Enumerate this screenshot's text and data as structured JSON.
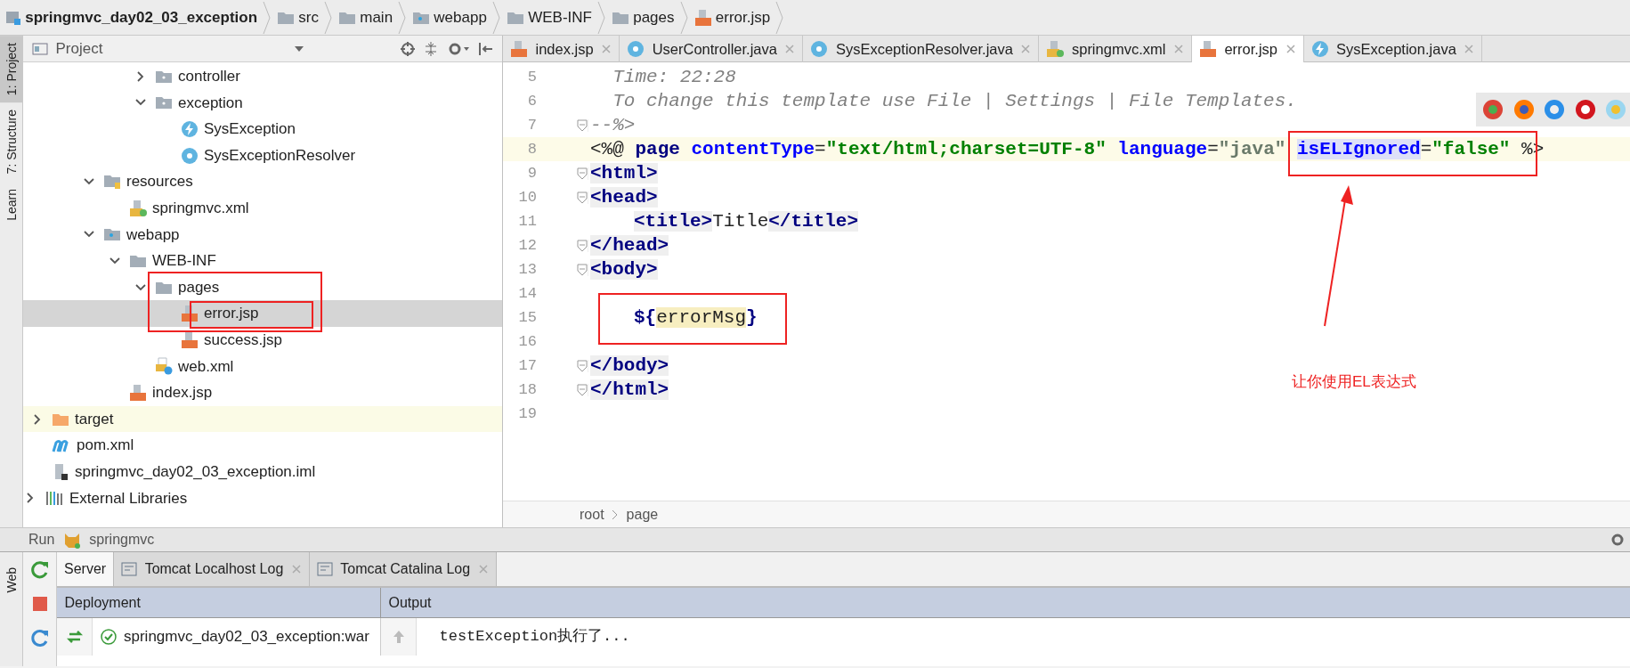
{
  "breadcrumbs": [
    {
      "label": "springmvc_day02_03_exception",
      "kind": "module"
    },
    {
      "label": "src",
      "kind": "folder"
    },
    {
      "label": "main",
      "kind": "folder"
    },
    {
      "label": "webapp",
      "kind": "web-folder"
    },
    {
      "label": "WEB-INF",
      "kind": "folder"
    },
    {
      "label": "pages",
      "kind": "folder"
    },
    {
      "label": "error.jsp",
      "kind": "jsp"
    }
  ],
  "tool_strip": {
    "tabs": [
      {
        "label": "1: Project",
        "selected": true
      },
      {
        "label": "7: Structure",
        "selected": false
      },
      {
        "label": "Learn",
        "selected": false
      }
    ],
    "bottom_tabs": [
      {
        "label": "Web",
        "selected": false
      }
    ]
  },
  "project_panel": {
    "title": "Project",
    "tree": [
      {
        "children": [
          {
            "children": [
              {
                "children": [
                  {
                    "children": [
                      {
                        "children": [
                          {
                            "label": "controller",
                            "kind": "package",
                            "expanded": false,
                            "selected": false
                          },
                          {
                            "label": "exception",
                            "kind": "package",
                            "expanded": true,
                            "selected": false,
                            "children": [
                              {
                                "label": "SysException",
                                "kind": "exception",
                                "selected": false
                              },
                              {
                                "label": "SysExceptionResolver",
                                "kind": "class",
                                "selected": false
                              }
                            ]
                          }
                        ]
                      }
                    ]
                  },
                  {
                    "label": "resources",
                    "kind": "resources",
                    "expanded": true,
                    "selected": false,
                    "children": [
                      {
                        "label": "springmvc.xml",
                        "kind": "xml",
                        "selected": false
                      }
                    ]
                  },
                  {
                    "label": "webapp",
                    "kind": "web-folder",
                    "expanded": true,
                    "selected": false,
                    "children": [
                      {
                        "label": "WEB-INF",
                        "kind": "folder",
                        "expanded": true,
                        "selected": false,
                        "children": [
                          {
                            "label": "pages",
                            "kind": "folder",
                            "expanded": true,
                            "selected": false,
                            "children": [
                              {
                                "label": "error.jsp",
                                "kind": "jsp",
                                "selected": true
                              },
                              {
                                "label": "success.jsp",
                                "kind": "jsp",
                                "selected": false
                              }
                            ]
                          },
                          {
                            "label": "web.xml",
                            "kind": "webxml",
                            "selected": false
                          }
                        ]
                      },
                      {
                        "label": "index.jsp",
                        "kind": "jsp",
                        "selected": false
                      }
                    ]
                  }
                ]
              }
            ]
          },
          {
            "label": "target",
            "kind": "excluded",
            "expanded": false,
            "selected": false
          },
          {
            "label": "pom.xml",
            "kind": "maven",
            "selected": false
          },
          {
            "label": "springmvc_day02_03_exception.iml",
            "kind": "iml",
            "selected": false
          }
        ]
      },
      {
        "label": "External Libraries",
        "kind": "library",
        "expanded": false,
        "selected": false
      }
    ]
  },
  "editor": {
    "tabs": [
      {
        "label": "index.jsp",
        "kind": "jsp",
        "selected": false
      },
      {
        "label": "UserController.java",
        "kind": "class",
        "selected": false
      },
      {
        "label": "SysExceptionResolver.java",
        "kind": "class",
        "selected": false
      },
      {
        "label": "springmvc.xml",
        "kind": "xml",
        "selected": false
      },
      {
        "label": "error.jsp",
        "kind": "jsp",
        "selected": true
      },
      {
        "label": "SysException.java",
        "kind": "exception",
        "selected": false
      }
    ],
    "lines": [
      {
        "number": "5",
        "fold": false,
        "current": false,
        "segments": [
          {
            "text": "  Time: 22:28",
            "kind": "comment"
          }
        ]
      },
      {
        "number": "6",
        "fold": false,
        "current": false,
        "segments": [
          {
            "text": "  To change this template use File | Settings | File Templates.",
            "kind": "comment"
          }
        ]
      },
      {
        "number": "7",
        "fold": true,
        "current": false,
        "segments": [
          {
            "text": "--%>",
            "kind": "comment"
          }
        ]
      },
      {
        "number": "8",
        "fold": false,
        "current": true,
        "segments": [
          {
            "text": "<%@ ",
            "kind": "plain"
          },
          {
            "text": "page",
            "kind": "directive"
          },
          {
            "text": " contentType",
            "kind": "attr"
          },
          {
            "text": "=",
            "kind": "plain"
          },
          {
            "text": "\"text/html;charset=UTF-8\"",
            "kind": "string"
          },
          {
            "text": " language",
            "kind": "attr"
          },
          {
            "text": "=",
            "kind": "plain"
          },
          {
            "text": "\"java\" ",
            "kind": "string-dim"
          },
          {
            "text": "isELIgnored",
            "kind": "attr-hl"
          },
          {
            "text": "=",
            "kind": "plain"
          },
          {
            "text": "\"false\"",
            "kind": "string"
          },
          {
            "text": " %>",
            "kind": "plain"
          }
        ]
      },
      {
        "number": "9",
        "fold": true,
        "current": false,
        "segments": [
          {
            "text": "<html>",
            "kind": "tag"
          }
        ]
      },
      {
        "number": "10",
        "fold": true,
        "current": false,
        "segments": [
          {
            "text": "<head>",
            "kind": "tag"
          }
        ]
      },
      {
        "number": "11",
        "fold": false,
        "current": false,
        "indented": true,
        "segments": [
          {
            "text": "<title>",
            "kind": "tag"
          },
          {
            "text": "Title",
            "kind": "plain"
          },
          {
            "text": "</title>",
            "kind": "tag"
          }
        ]
      },
      {
        "number": "12",
        "fold": true,
        "current": false,
        "segments": [
          {
            "text": "</head>",
            "kind": "tag"
          }
        ]
      },
      {
        "number": "13",
        "fold": true,
        "current": false,
        "segments": [
          {
            "text": "<body>",
            "kind": "tag"
          }
        ]
      },
      {
        "number": "14",
        "fold": false,
        "current": false
      },
      {
        "number": "15",
        "fold": false,
        "current": false,
        "indented": true,
        "segments": [
          {
            "text": "${",
            "kind": "el"
          },
          {
            "text": "errorMsg",
            "kind": "el-var"
          },
          {
            "text": "}",
            "kind": "el"
          }
        ]
      },
      {
        "number": "16",
        "fold": false,
        "current": false
      },
      {
        "number": "17",
        "fold": true,
        "current": false,
        "segments": [
          {
            "text": "</body>",
            "kind": "tag"
          }
        ]
      },
      {
        "number": "18",
        "fold": true,
        "current": false,
        "segments": [
          {
            "text": "</html>",
            "kind": "tag"
          }
        ]
      },
      {
        "number": "19",
        "fold": false,
        "current": false
      }
    ],
    "breadcrumb": [
      "root",
      "page"
    ],
    "note": "让你使用EL表达式"
  },
  "run_panel": {
    "title": "Run",
    "config": "springmvc",
    "tabs": [
      {
        "label": "Server",
        "selected": true,
        "closable": false
      },
      {
        "label": "Tomcat Localhost Log",
        "selected": false,
        "closable": true
      },
      {
        "label": "Tomcat Catalina Log",
        "selected": false,
        "closable": true
      }
    ],
    "columns": [
      "Deployment",
      "Output"
    ],
    "deployment": "springmvc_day02_03_exception:war",
    "output": "testException执行了..."
  }
}
